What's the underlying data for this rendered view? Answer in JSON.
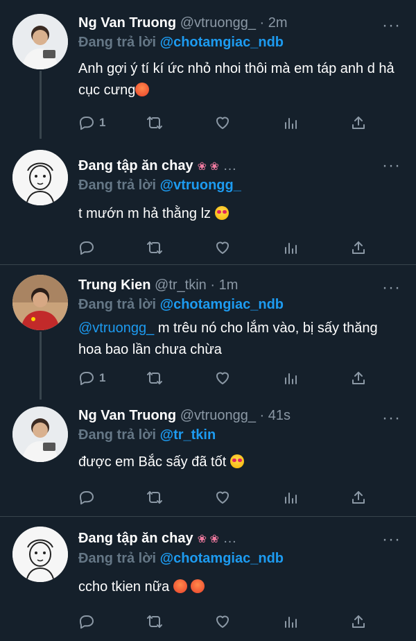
{
  "tweets": [
    {
      "name": "Ng Van Truong",
      "handle": "@vtruongg_",
      "time": "2m",
      "replying_label": "Đang trả lời",
      "replying_to": "@chotamgiac_ndb",
      "text": "Anh gợi ý tí kí ức nhỏ nhoi thôi mà em táp anh d hả cục cưng",
      "emoji": "angry-face",
      "reply_count": "1"
    },
    {
      "name": "Đang tập ăn chay",
      "handle": "",
      "time": "",
      "name_emoji": "lotus-lotus",
      "replying_label": "Đang trả lời",
      "replying_to": "@vtruongg_",
      "text": "t mướn m hả thằng lz",
      "emoji": "heart-eyes-face",
      "reply_count": ""
    },
    {
      "name": "Trung Kien",
      "handle": "@tr_tkin",
      "time": "1m",
      "replying_label": "Đang trả lời",
      "replying_to": "@chotamgiac_ndb",
      "mention": "@vtruongg_",
      "text": "m trêu nó cho lắm vào, bị sấy thăng hoa bao lần chưa chừa",
      "reply_count": "1"
    },
    {
      "name": "Ng Van Truong",
      "handle": "@vtruongg_",
      "time": "41s",
      "replying_label": "Đang trả lời",
      "replying_to": "@tr_tkin",
      "text": "được em Bắc sấy đã tốt",
      "emoji": "heart-eyes-face",
      "reply_count": ""
    },
    {
      "name": "Đang tập ăn chay",
      "handle": "",
      "time": "",
      "name_emoji": "lotus-lotus",
      "replying_label": "Đang trả lời",
      "replying_to": "@chotamgiac_ndb",
      "text": "ccho tkien nữa",
      "emoji": "angry-face-angry-face",
      "reply_count": ""
    }
  ],
  "separator": "·",
  "more_glyph": "···",
  "icons": [
    "reply-icon",
    "retweet-icon",
    "like-icon",
    "analytics-icon",
    "share-icon"
  ],
  "colors": {
    "background": "#15202b",
    "accent": "#1d9bf0",
    "muted": "#8b98a5",
    "border": "#38444d"
  }
}
